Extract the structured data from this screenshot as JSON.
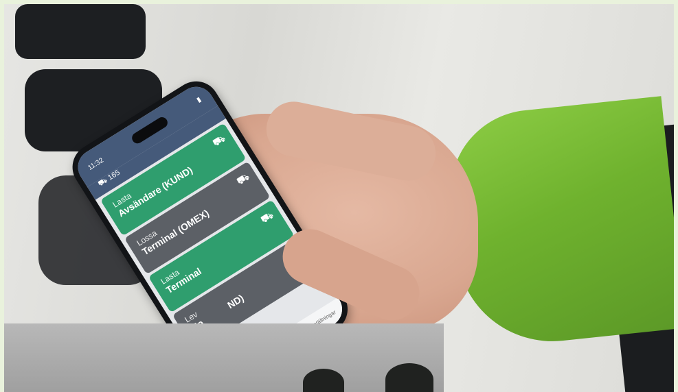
{
  "phone": {
    "status_time": "11:32",
    "status_truck_id": "165",
    "tiles": [
      {
        "action": "Lasta",
        "place": "Avsändare (KUND)",
        "color": "#2f9e6e",
        "icon": "people-truck-icon"
      },
      {
        "action": "Lossa",
        "place": "Terminal (OMEX)",
        "color": "#5c6066",
        "icon": "truck-icon"
      },
      {
        "action": "Lasta",
        "place": "Terminal",
        "color": "#2f9e6e",
        "icon": "truck-icon"
      },
      {
        "action": "Lev",
        "place": "Mo",
        "fragment": "ND)",
        "color": "#5c6066",
        "icon": "person-truck-icon"
      }
    ],
    "settings_label": "Inställningar"
  }
}
